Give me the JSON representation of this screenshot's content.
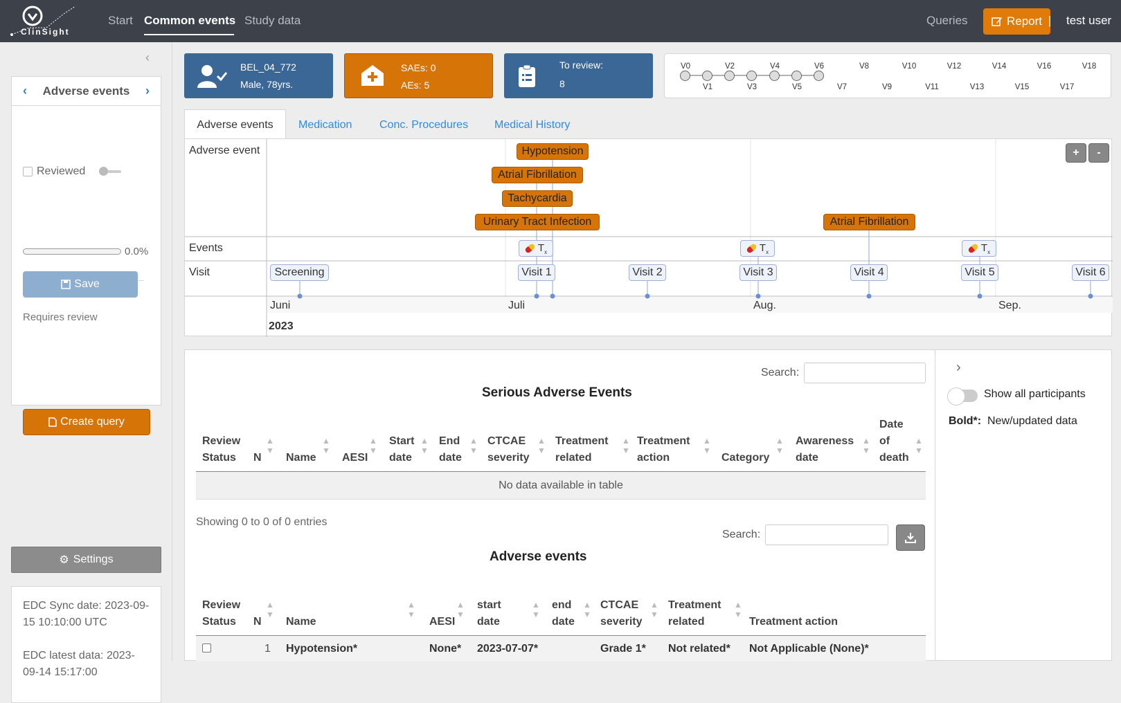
{
  "nav": {
    "logo_text": "ClinSight",
    "links": [
      "Start",
      "Common events",
      "Study data"
    ],
    "queries_label": "Queries",
    "report_label": "Report",
    "separator": "|",
    "user_label": "test user"
  },
  "sidebar": {
    "collapse_icon": "chevron-left-icon",
    "form_title": "Adverse events",
    "reviewed_label": "Reviewed",
    "progress_value": "0.0%",
    "progress_fraction": 0,
    "save_label": "Save",
    "requires_review_label": "Requires review",
    "create_query_label": "Create query",
    "settings_label": "Settings",
    "sync_text": "EDC Sync date: 2023-09-15 10:10:00 UTC",
    "latest_text": "EDC latest data: 2023-09-14 15:17:00"
  },
  "header": {
    "subject_id": "BEL_04_772",
    "subject_info": "Male, 78yrs.",
    "saes": "SAEs: 0",
    "aes": "AEs: 5",
    "to_review_label": "To review:",
    "to_review_count": "8",
    "colors": {
      "subject": "#3b6797",
      "events": "#d67408",
      "review": "#3b6797"
    }
  },
  "visits_top": [
    "V0",
    "V2",
    "V4",
    "V6",
    "V8",
    "V10",
    "V12",
    "V14",
    "V16",
    "V18"
  ],
  "visits_bottom": [
    "V1",
    "V3",
    "V5",
    "V7",
    "V9",
    "V11",
    "V13",
    "V15",
    "V17"
  ],
  "tabs": [
    "Adverse events",
    "Medication",
    "Conc. Procedures",
    "Medical History"
  ],
  "timeline": {
    "row_labels": {
      "ae": "Adverse event",
      "events": "Events",
      "visit": "Visit"
    },
    "adverse_events": [
      "Hypotension",
      "Atrial Fibrillation",
      "Tachycardia",
      "Urinary Tract Infection",
      "Atrial Fibrillation"
    ],
    "event_symbol": "T",
    "event_subscript": "x",
    "visits": [
      "Screening",
      "Visit 1",
      "Visit 2",
      "Visit 3",
      "Visit 4",
      "Visit 5",
      "Visit 6"
    ],
    "months": [
      "Juni",
      "Juli",
      "Aug.",
      "Sep."
    ],
    "year": "2023",
    "zoom_in": "+",
    "zoom_out": "-"
  },
  "sae_table": {
    "search_label": "Search:",
    "title": "Serious Adverse Events",
    "headers": [
      [
        "Review",
        "Status"
      ],
      [
        "N"
      ],
      [
        "Name"
      ],
      [
        "AESI"
      ],
      [
        "Start",
        "date"
      ],
      [
        "End",
        "date"
      ],
      [
        "CTCAE",
        "severity"
      ],
      [
        "Treatment",
        "related"
      ],
      [
        "Treatment",
        "action"
      ],
      [
        "Category"
      ],
      [
        "Awareness",
        "date"
      ],
      [
        "Date",
        "of",
        "death"
      ]
    ],
    "empty_text": "No data available in table",
    "info_text": "Showing 0 to 0 of 0 entries"
  },
  "ae_table": {
    "search_label": "Search:",
    "title": "Adverse events",
    "headers": [
      [
        "Review",
        "Status"
      ],
      [
        "N"
      ],
      [
        "Name"
      ],
      [
        "AESI"
      ],
      [
        "start",
        "date"
      ],
      [
        "end",
        "date"
      ],
      [
        "CTCAE",
        "severity"
      ],
      [
        "Treatment",
        "related"
      ],
      [
        "Treatment action"
      ]
    ],
    "rows": [
      {
        "n": "1",
        "name": "Hypotension*",
        "aesi": "None*",
        "start": "2023-07-07*",
        "end": "",
        "severity": "Grade 1*",
        "related": "Not related*",
        "action": "Not Applicable (None)*"
      }
    ]
  },
  "right_panel": {
    "expand_icon": "chevron-right-icon",
    "show_all_label": "Show all participants",
    "legend_bold": "Bold*:",
    "legend_text": "New/updated data"
  }
}
